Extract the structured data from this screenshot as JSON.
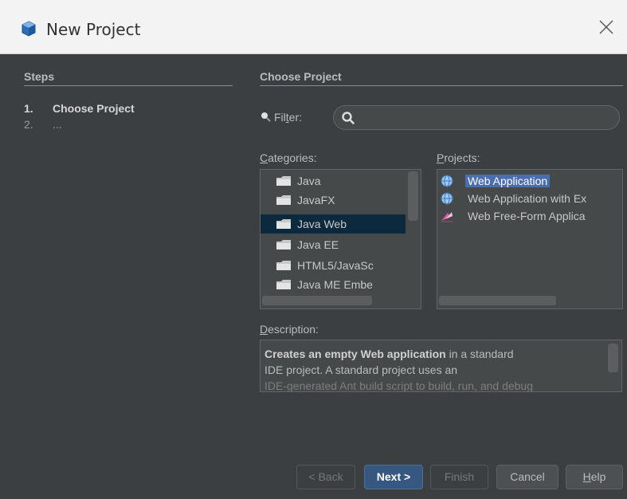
{
  "window": {
    "title": "New Project",
    "close_icon": "close-icon",
    "app_icon": "netbeans-cube-icon"
  },
  "steps": {
    "header": "Steps",
    "items": [
      {
        "number": "1.",
        "label": "Choose Project"
      },
      {
        "number": "2.",
        "label": "..."
      }
    ]
  },
  "main": {
    "header": "Choose Project",
    "filter": {
      "label_pre": "Fil",
      "label_mnemonic": "t",
      "label_post": "er:",
      "value": ""
    },
    "categories": {
      "label_mnemonic": "C",
      "label_rest": "ategories:",
      "items": [
        "Java",
        "JavaFX",
        "Java Web",
        "Java EE",
        "HTML5/JavaSc",
        "Java ME Embe"
      ],
      "selected_index": 2
    },
    "projects": {
      "label_mnemonic": "P",
      "label_rest": "rojects:",
      "items": [
        "Web Application",
        "Web Application with Ex",
        "Web Free-Form Applica"
      ],
      "selected_index": 0
    },
    "description": {
      "label_mnemonic": "D",
      "label_rest": "escription:",
      "bold": "Creates an empty Web application",
      "text1": " in a standard",
      "text2": "IDE project. A standard project uses an",
      "text3": "IDE-generated Ant build script to build, run, and debug"
    }
  },
  "buttons": {
    "back": "< Back",
    "next": "Next >",
    "finish": "Finish",
    "cancel": "Cancel",
    "help_mnemonic": "H",
    "help_rest": "elp"
  },
  "colors": {
    "background": "#3c3f41",
    "selection": "#4b6eaf",
    "category_selection": "#0d293e",
    "default_button": "#365880"
  }
}
